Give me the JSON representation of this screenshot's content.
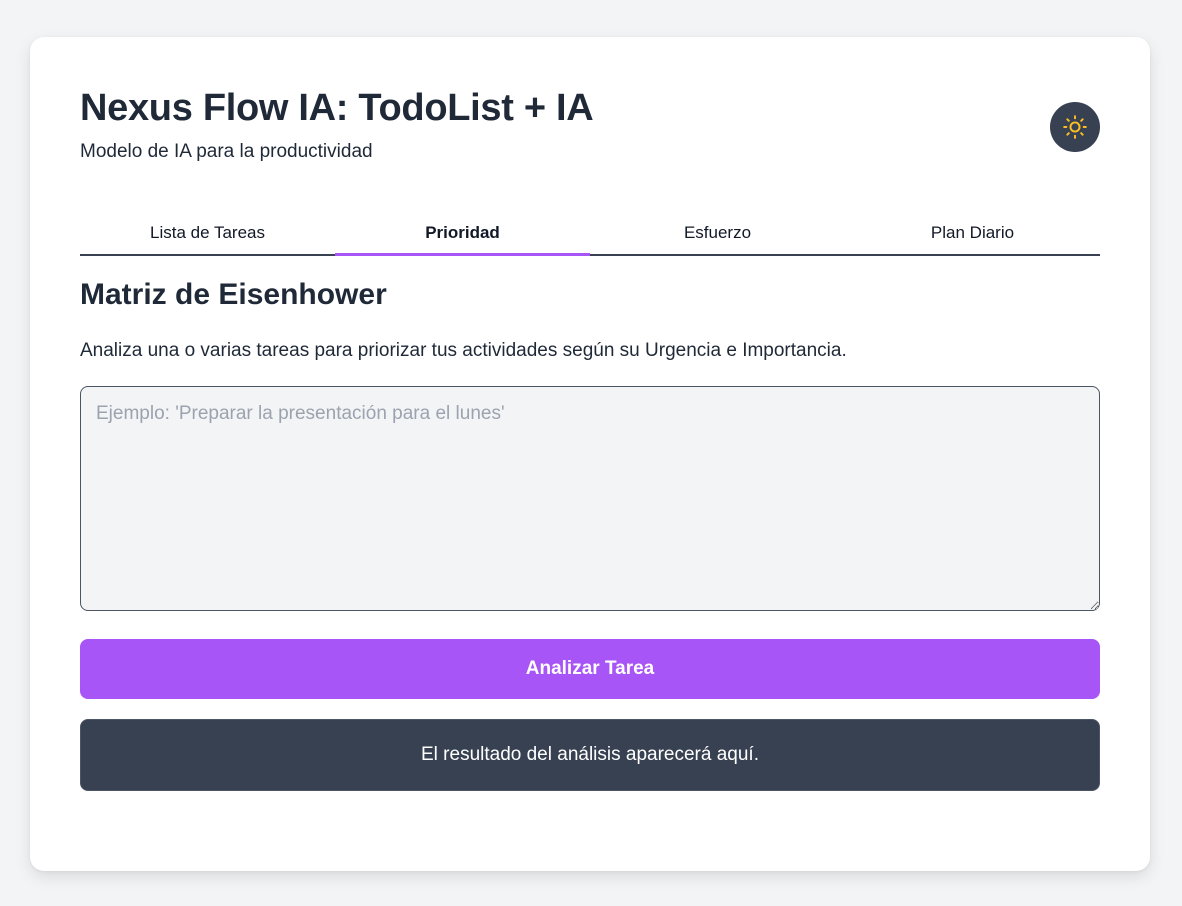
{
  "header": {
    "title": "Nexus Flow IA: TodoList + IA",
    "subtitle": "Modelo de IA para la productividad",
    "theme_toggle_icon": "sun-icon"
  },
  "tabs": [
    {
      "label": "Lista de Tareas",
      "active": false
    },
    {
      "label": "Prioridad",
      "active": true
    },
    {
      "label": "Esfuerzo",
      "active": false
    },
    {
      "label": "Plan Diario",
      "active": false
    }
  ],
  "main": {
    "section_title": "Matriz de Eisenhower",
    "description": "Analiza una o varias tareas para priorizar tus actividades según su Urgencia e Importancia.",
    "task_input": {
      "value": "",
      "placeholder": "Ejemplo: 'Preparar la presentación para el lunes'"
    },
    "analyze_button_label": "Analizar Tarea",
    "result_text": "El resultado del análisis aparecerá aquí."
  },
  "colors": {
    "page_background": "#f3f4f6",
    "card_background": "#ffffff",
    "accent": "#a855f7",
    "dark_surface": "#374151",
    "sun_icon": "#fbbf24",
    "text": "#1f2937"
  }
}
